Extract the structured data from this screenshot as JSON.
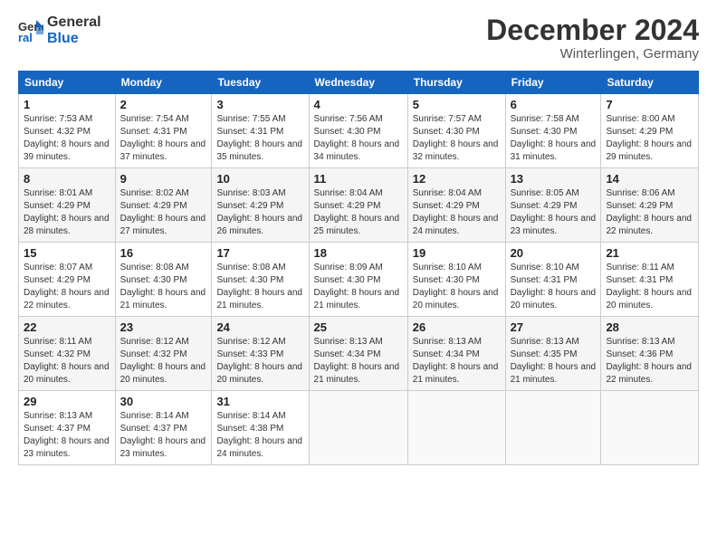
{
  "logo": {
    "line1": "General",
    "line2": "Blue"
  },
  "title": "December 2024",
  "subtitle": "Winterlingen, Germany",
  "days_header": [
    "Sunday",
    "Monday",
    "Tuesday",
    "Wednesday",
    "Thursday",
    "Friday",
    "Saturday"
  ],
  "weeks": [
    [
      {
        "num": "1",
        "sunrise": "7:53 AM",
        "sunset": "4:32 PM",
        "daylight": "8 hours and 39 minutes."
      },
      {
        "num": "2",
        "sunrise": "7:54 AM",
        "sunset": "4:31 PM",
        "daylight": "8 hours and 37 minutes."
      },
      {
        "num": "3",
        "sunrise": "7:55 AM",
        "sunset": "4:31 PM",
        "daylight": "8 hours and 35 minutes."
      },
      {
        "num": "4",
        "sunrise": "7:56 AM",
        "sunset": "4:30 PM",
        "daylight": "8 hours and 34 minutes."
      },
      {
        "num": "5",
        "sunrise": "7:57 AM",
        "sunset": "4:30 PM",
        "daylight": "8 hours and 32 minutes."
      },
      {
        "num": "6",
        "sunrise": "7:58 AM",
        "sunset": "4:30 PM",
        "daylight": "8 hours and 31 minutes."
      },
      {
        "num": "7",
        "sunrise": "8:00 AM",
        "sunset": "4:29 PM",
        "daylight": "8 hours and 29 minutes."
      }
    ],
    [
      {
        "num": "8",
        "sunrise": "8:01 AM",
        "sunset": "4:29 PM",
        "daylight": "8 hours and 28 minutes."
      },
      {
        "num": "9",
        "sunrise": "8:02 AM",
        "sunset": "4:29 PM",
        "daylight": "8 hours and 27 minutes."
      },
      {
        "num": "10",
        "sunrise": "8:03 AM",
        "sunset": "4:29 PM",
        "daylight": "8 hours and 26 minutes."
      },
      {
        "num": "11",
        "sunrise": "8:04 AM",
        "sunset": "4:29 PM",
        "daylight": "8 hours and 25 minutes."
      },
      {
        "num": "12",
        "sunrise": "8:04 AM",
        "sunset": "4:29 PM",
        "daylight": "8 hours and 24 minutes."
      },
      {
        "num": "13",
        "sunrise": "8:05 AM",
        "sunset": "4:29 PM",
        "daylight": "8 hours and 23 minutes."
      },
      {
        "num": "14",
        "sunrise": "8:06 AM",
        "sunset": "4:29 PM",
        "daylight": "8 hours and 22 minutes."
      }
    ],
    [
      {
        "num": "15",
        "sunrise": "8:07 AM",
        "sunset": "4:29 PM",
        "daylight": "8 hours and 22 minutes."
      },
      {
        "num": "16",
        "sunrise": "8:08 AM",
        "sunset": "4:30 PM",
        "daylight": "8 hours and 21 minutes."
      },
      {
        "num": "17",
        "sunrise": "8:08 AM",
        "sunset": "4:30 PM",
        "daylight": "8 hours and 21 minutes."
      },
      {
        "num": "18",
        "sunrise": "8:09 AM",
        "sunset": "4:30 PM",
        "daylight": "8 hours and 21 minutes."
      },
      {
        "num": "19",
        "sunrise": "8:10 AM",
        "sunset": "4:30 PM",
        "daylight": "8 hours and 20 minutes."
      },
      {
        "num": "20",
        "sunrise": "8:10 AM",
        "sunset": "4:31 PM",
        "daylight": "8 hours and 20 minutes."
      },
      {
        "num": "21",
        "sunrise": "8:11 AM",
        "sunset": "4:31 PM",
        "daylight": "8 hours and 20 minutes."
      }
    ],
    [
      {
        "num": "22",
        "sunrise": "8:11 AM",
        "sunset": "4:32 PM",
        "daylight": "8 hours and 20 minutes."
      },
      {
        "num": "23",
        "sunrise": "8:12 AM",
        "sunset": "4:32 PM",
        "daylight": "8 hours and 20 minutes."
      },
      {
        "num": "24",
        "sunrise": "8:12 AM",
        "sunset": "4:33 PM",
        "daylight": "8 hours and 20 minutes."
      },
      {
        "num": "25",
        "sunrise": "8:13 AM",
        "sunset": "4:34 PM",
        "daylight": "8 hours and 21 minutes."
      },
      {
        "num": "26",
        "sunrise": "8:13 AM",
        "sunset": "4:34 PM",
        "daylight": "8 hours and 21 minutes."
      },
      {
        "num": "27",
        "sunrise": "8:13 AM",
        "sunset": "4:35 PM",
        "daylight": "8 hours and 21 minutes."
      },
      {
        "num": "28",
        "sunrise": "8:13 AM",
        "sunset": "4:36 PM",
        "daylight": "8 hours and 22 minutes."
      }
    ],
    [
      {
        "num": "29",
        "sunrise": "8:13 AM",
        "sunset": "4:37 PM",
        "daylight": "8 hours and 23 minutes."
      },
      {
        "num": "30",
        "sunrise": "8:14 AM",
        "sunset": "4:37 PM",
        "daylight": "8 hours and 23 minutes."
      },
      {
        "num": "31",
        "sunrise": "8:14 AM",
        "sunset": "4:38 PM",
        "daylight": "8 hours and 24 minutes."
      },
      null,
      null,
      null,
      null
    ]
  ],
  "labels": {
    "sunrise": "Sunrise:",
    "sunset": "Sunset:",
    "daylight": "Daylight:"
  }
}
